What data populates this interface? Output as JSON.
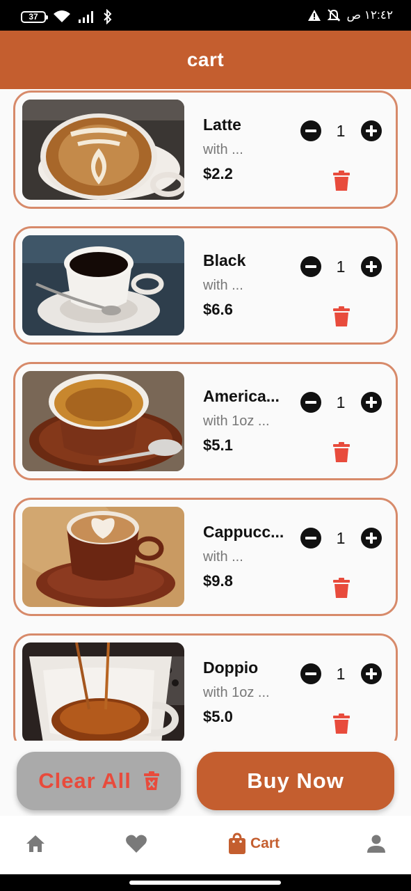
{
  "status_bar": {
    "battery": "37",
    "time": "١٢:٤٢ ص"
  },
  "app_bar": {
    "title": "cart"
  },
  "cart_items": [
    {
      "name": "Latte",
      "desc": "with ...",
      "price": "$2.2",
      "qty": "1"
    },
    {
      "name": "Black",
      "desc": "with ...",
      "price": "$6.6",
      "qty": "1"
    },
    {
      "name": "America...",
      "desc": "with 1oz ...",
      "price": "$5.1",
      "qty": "1"
    },
    {
      "name": "Cappucc...",
      "desc": "with ...",
      "price": "$9.8",
      "qty": "1"
    },
    {
      "name": "Doppio",
      "desc": "with 1oz ...",
      "price": "$5.0",
      "qty": "1"
    }
  ],
  "actions": {
    "clear_label": "Clear All",
    "buy_label": "Buy Now"
  },
  "bottom_nav": {
    "cart_label": "Cart"
  },
  "icons": [
    "battery-icon",
    "wifi-icon",
    "signal-icon",
    "bluetooth-icon",
    "warning-icon",
    "bell-off-icon",
    "minus-icon",
    "plus-icon",
    "trash-icon",
    "home-icon",
    "heart-icon",
    "bag-icon",
    "person-icon"
  ],
  "colors": {
    "primary": "#c45e2f",
    "delete": "#e84b3c",
    "card_border": "#d78a6a"
  }
}
